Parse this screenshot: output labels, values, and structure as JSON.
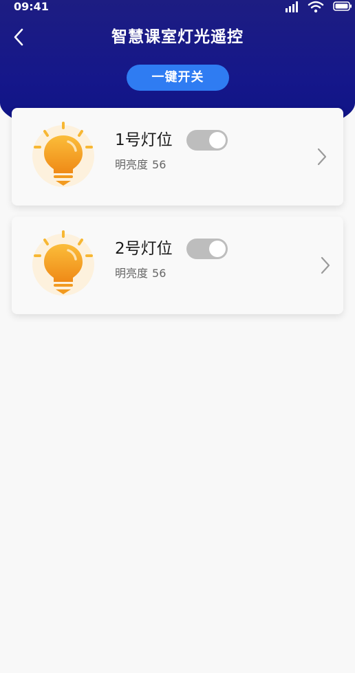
{
  "status_bar": {
    "time": "09:41"
  },
  "header": {
    "title": "智慧课室灯光遥控",
    "toggle_all_label": "一键开关",
    "background_color": "#15178a",
    "button_color": "#2f7cf2"
  },
  "lights": [
    {
      "name": "1号灯位",
      "brightness_label": "明亮度",
      "brightness_value": "56",
      "toggle_state": "off"
    },
    {
      "name": "2号灯位",
      "brightness_label": "明亮度",
      "brightness_value": "56",
      "toggle_state": "off"
    }
  ],
  "icons": {
    "back": "chevron-left-icon",
    "bulb": "lightbulb-icon",
    "detail": "chevron-right-icon"
  }
}
